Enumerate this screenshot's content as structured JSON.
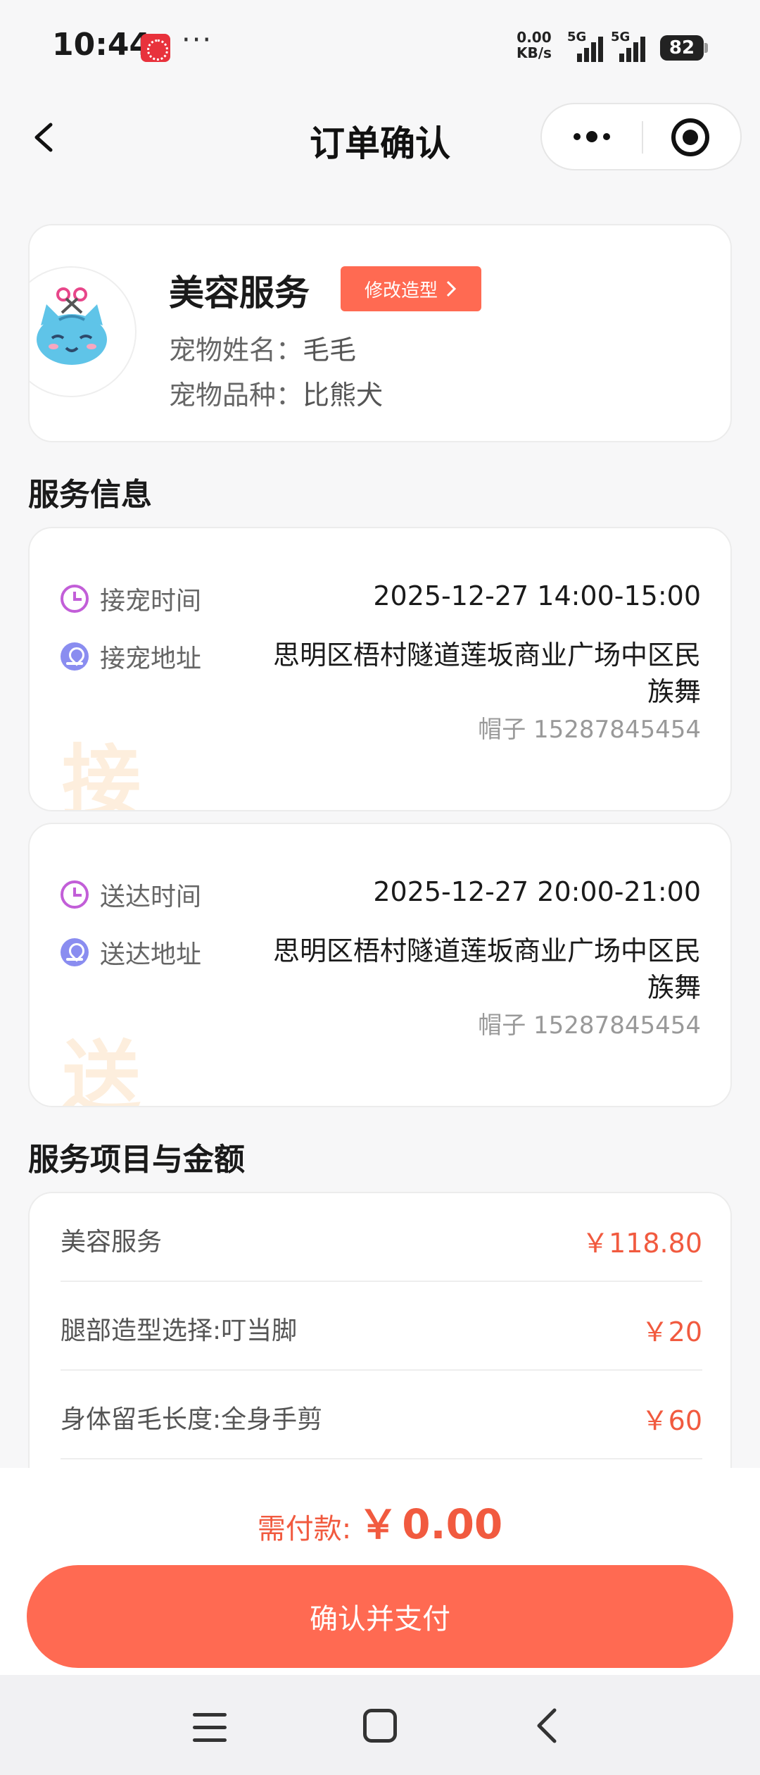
{
  "status_bar": {
    "time": "10:44",
    "dots": "···",
    "net_speed_value": "0.00",
    "net_speed_unit": "KB/s",
    "signal_1_label": "5G",
    "signal_2_label": "5G",
    "battery": "82"
  },
  "nav": {
    "title": "订单确认"
  },
  "pet_card": {
    "service_name": "美容服务",
    "modify_label": "修改造型",
    "pet_name_key": "宠物姓名：",
    "pet_name": "毛毛",
    "pet_breed_key": "宠物品种：",
    "pet_breed": "比熊犬"
  },
  "service_info": {
    "section_title": "服务信息",
    "pickup": {
      "time_label": "接宠时间",
      "time_value": "2025-12-27 14:00-15:00",
      "address_label": "接宠地址",
      "address": "思明区梧村隧道莲坂商业广场中区民族舞",
      "contact": "帽子 15287845454",
      "watermark": "接"
    },
    "delivery": {
      "time_label": "送达时间",
      "time_value": "2025-12-27 20:00-21:00",
      "address_label": "送达地址",
      "address": "思明区梧村隧道莲坂商业广场中区民族舞",
      "contact": "帽子 15287845454",
      "watermark": "送"
    }
  },
  "items": {
    "section_title": "服务项目与金额",
    "rows": [
      {
        "name": "美容服务",
        "price": "￥118.80"
      },
      {
        "name": "腿部造型选择:叮当脚",
        "price": "￥20"
      },
      {
        "name": "身体留毛长度:全身手剪",
        "price": "￥60"
      }
    ]
  },
  "payment": {
    "label": "需付款:",
    "currency": "￥",
    "amount": "0.00",
    "button_label": "确认并支付"
  },
  "colors": {
    "accent": "#ff6a52",
    "price": "#f15a3f",
    "clock_icon": "#c25ed8",
    "pin_icon": "#8a8df0"
  }
}
